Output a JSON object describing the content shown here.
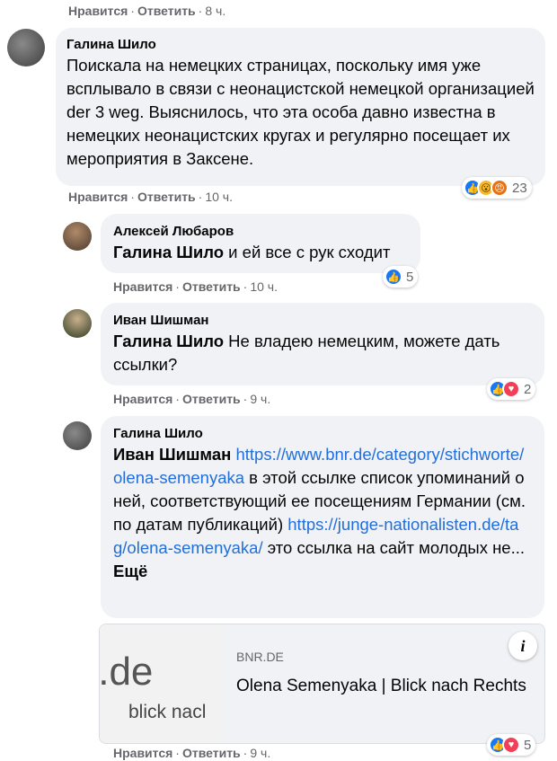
{
  "top_actions": {
    "like": "Нравится",
    "reply": "Ответить",
    "time": "8 ч."
  },
  "comments": [
    {
      "author": "Галина Шило",
      "text": "Поискала на немецких страницах, поскольку имя уже всплывало в связи с неонацистской немецкой организацией der 3 weg. Выяснилось, что эта особа давно известна в немецких неонацистских кругах и регулярно посещает их мероприятия в Заксене.",
      "like": "Нравится",
      "reply": "Ответить",
      "time": "10 ч.",
      "reactions": {
        "icons": [
          "like-icon",
          "wow-icon",
          "angry-icon"
        ],
        "count": "23"
      }
    },
    {
      "author": "Алексей Любаров",
      "mention": "Галина Шило",
      "text": " и ей все с рук сходит",
      "like": "Нравится",
      "reply": "Ответить",
      "time": "10 ч.",
      "reactions": {
        "icons": [
          "like-icon"
        ],
        "count": "5"
      }
    },
    {
      "author": "Иван Шишман",
      "mention": "Галина Шило",
      "text": " Не владею немецким, можете дать ссылки?",
      "like": "Нравится",
      "reply": "Ответить",
      "time": "9 ч.",
      "reactions": {
        "icons": [
          "like-icon",
          "care-icon"
        ],
        "count": "2"
      }
    },
    {
      "author": "Галина Шило",
      "mention": "Иван Шишман",
      "link1": "https://www.bnr.de/category/stichworte/olena-semenyaka",
      "text1": " в этой ссылке список упоминаний о ней, соответствующий ее посещениям Германии (см. по датам публикаций) ",
      "link2": "https://junge-nationalisten.de/tag/olena-semenyaka/",
      "text2": " это ссылка на сайт молодых не... ",
      "more": "Ещё",
      "like": "Нравится",
      "reply": "Ответить",
      "time": "9 ч.",
      "reactions": {
        "icons": [
          "like-icon",
          "care-icon"
        ],
        "count": "5"
      }
    }
  ],
  "link_card": {
    "domain": "BNR.DE",
    "title": "Olena Semenyaka | Blick nach Rechts",
    "thumb_big": "r.de",
    "thumb_small": "blick nacl"
  }
}
